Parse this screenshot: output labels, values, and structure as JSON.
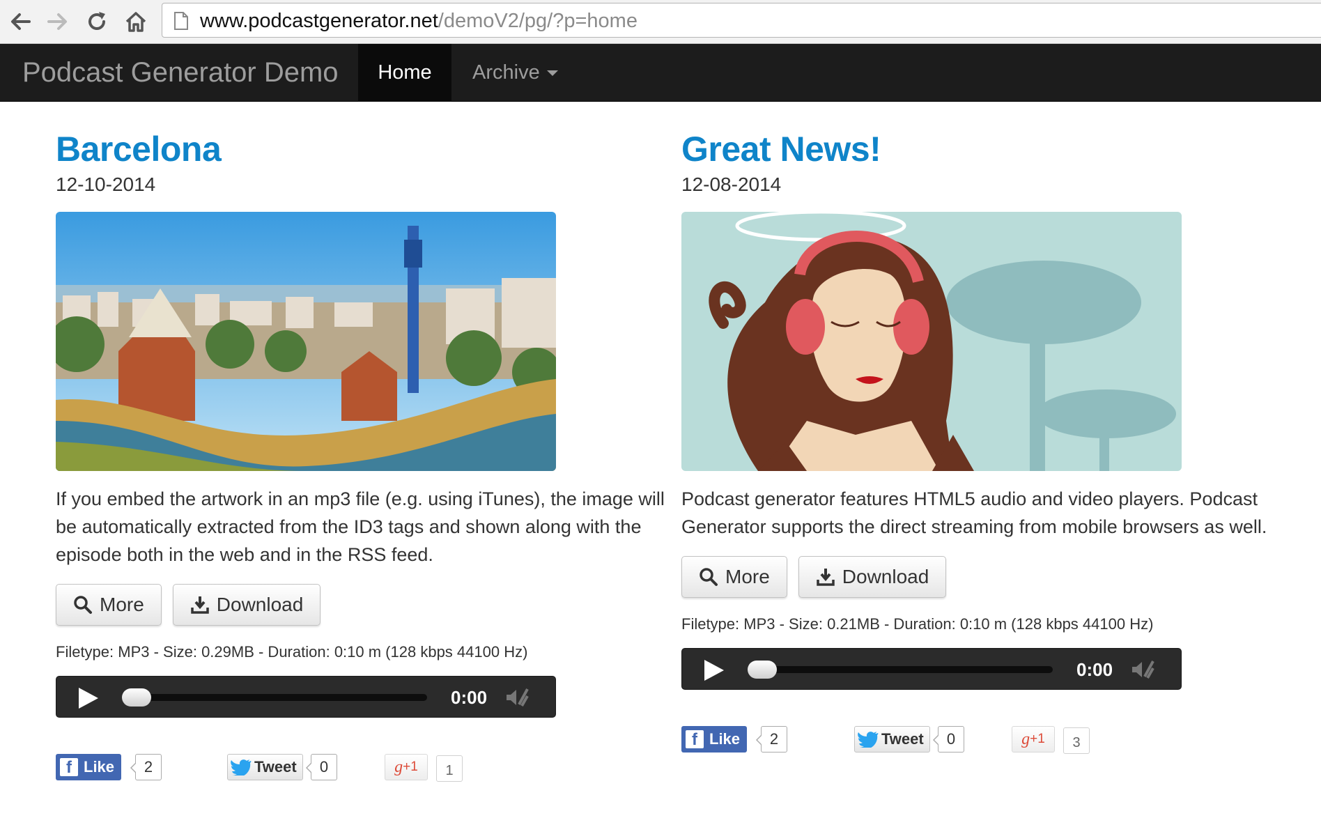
{
  "browser": {
    "back_icon": "arrow-left-icon",
    "forward_icon": "arrow-right-icon",
    "reload_icon": "reload-icon",
    "home_icon": "home-icon",
    "url_host": "www.podcastgenerator.net",
    "url_path": "/demoV2/pg/?p=home"
  },
  "navbar": {
    "brand": "Podcast Generator Demo",
    "home": "Home",
    "archive": "Archive"
  },
  "episodes": [
    {
      "title": "Barcelona",
      "date": "12-10-2014",
      "image": "barcelona-park-guell-photo",
      "description": "If you embed the artwork in an mp3 file (e.g. using iTunes), the image will be automatically extracted from the ID3 tags and shown along with the episode both in the web and in the RSS feed.",
      "more_label": "More",
      "download_label": "Download",
      "fileinfo": "Filetype: MP3 - Size: 0.29MB - Duration: 0:10 m (128 kbps 44100 Hz)",
      "player_time": "0:00",
      "player_progress": 0,
      "like_label": "Like",
      "like_count": "2",
      "tweet_label": "Tweet",
      "tweet_count": "0",
      "plusone_label": "+1",
      "plusone_count": "1"
    },
    {
      "title": "Great News!",
      "date": "12-08-2014",
      "image": "woman-with-headphones-illustration",
      "description": "Podcast generator features HTML5 audio and video players. Podcast Generator supports the direct streaming from mobile browsers as well.",
      "more_label": "More",
      "download_label": "Download",
      "fileinfo": "Filetype: MP3 - Size: 0.21MB - Duration: 0:10 m (128 kbps 44100 Hz)",
      "player_time": "0:00",
      "player_progress": 0,
      "like_label": "Like",
      "like_count": "2",
      "tweet_label": "Tweet",
      "tweet_count": "0",
      "plusone_label": "+1",
      "plusone_count": "3"
    }
  ],
  "colors": {
    "title_blue": "#0f84c9",
    "navbar_bg": "#1c1c1c",
    "facebook_blue": "#4267b2",
    "gplus_red": "#dd4b39"
  }
}
